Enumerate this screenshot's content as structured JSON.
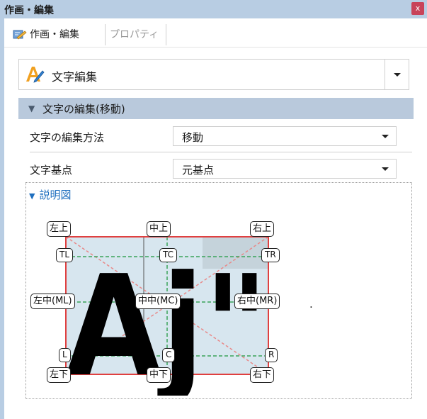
{
  "window": {
    "title": "作画・編集",
    "close_label": "x"
  },
  "tabs": [
    {
      "label": "作画・編集",
      "active": true
    },
    {
      "label": "プロパティ",
      "active": false
    }
  ],
  "command": {
    "label": "文字編集",
    "icon": "text-edit-icon"
  },
  "section": {
    "title": "文字の編集(移動)"
  },
  "properties": [
    {
      "label": "文字の編集方法",
      "value": "移動"
    },
    {
      "label": "文字基点",
      "value": "元基点"
    }
  ],
  "explanation": {
    "title": "説明図",
    "glyphs": "Aj\"",
    "trailing_text": ".",
    "labels": {
      "top_left": "左上",
      "top_center": "中上",
      "top_right": "右上",
      "tl": "TL",
      "tc": "TC",
      "tr": "TR",
      "middle_left": "左中(ML)",
      "middle_center": "中中(MC)",
      "middle_right": "右中(MR)",
      "l": "L",
      "c": "C",
      "r": "R",
      "bottom_left": "左下",
      "bottom_center": "中下",
      "bottom_right": "右下"
    }
  },
  "colors": {
    "title_bar": "#b8cde3",
    "section_header": "#b9c9dc",
    "close_button": "#c8435a",
    "link_blue": "#1f6fbf",
    "box_red": "#e04040",
    "guide_green": "#3aa35a",
    "fill_blue": "#d7e6ef"
  }
}
